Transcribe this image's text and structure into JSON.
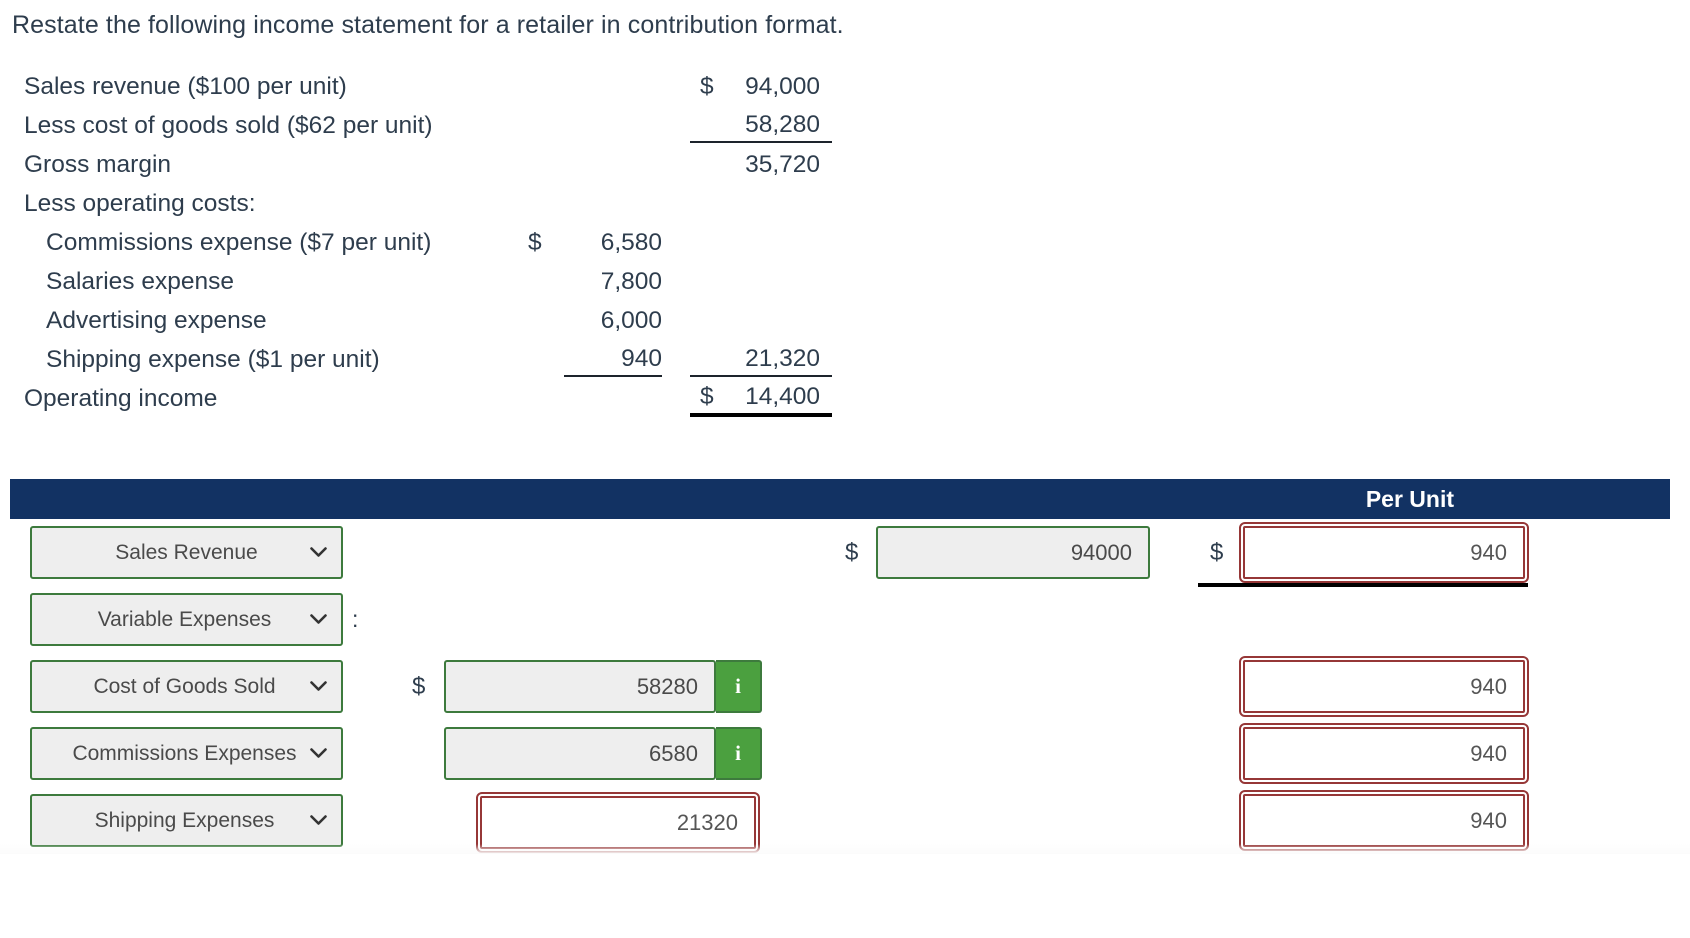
{
  "prompt": "Restate the following income statement for a retailer in contribution format.",
  "income_statement": {
    "rows": [
      {
        "label": "Sales revenue ($100 per unit)",
        "indent": false,
        "d1": "",
        "n1": "",
        "d2": "$",
        "n2": "94,000",
        "rule1": "",
        "rule2": ""
      },
      {
        "label": "Less cost of goods sold ($62 per unit)",
        "indent": false,
        "d1": "",
        "n1": "",
        "d2": "",
        "n2": "58,280",
        "rule1": "",
        "rule2": "thin"
      },
      {
        "label": "Gross margin",
        "indent": false,
        "d1": "",
        "n1": "",
        "d2": "",
        "n2": "35,720",
        "rule1": "",
        "rule2": ""
      },
      {
        "label": "Less operating costs:",
        "indent": false,
        "d1": "",
        "n1": "",
        "d2": "",
        "n2": "",
        "rule1": "",
        "rule2": ""
      },
      {
        "label": "Commissions expense ($7 per unit)",
        "indent": true,
        "d1": "$",
        "n1": "6,580",
        "d2": "",
        "n2": "",
        "rule1": "",
        "rule2": ""
      },
      {
        "label": "Salaries expense",
        "indent": true,
        "d1": "",
        "n1": "7,800",
        "d2": "",
        "n2": "",
        "rule1": "",
        "rule2": ""
      },
      {
        "label": "Advertising expense",
        "indent": true,
        "d1": "",
        "n1": "6,000",
        "d2": "",
        "n2": "",
        "rule1": "",
        "rule2": ""
      },
      {
        "label": "Shipping expense ($1 per unit)",
        "indent": true,
        "d1": "",
        "n1": "940",
        "d2": "",
        "n2": "21,320",
        "rule1": "thin",
        "rule2": "thin"
      },
      {
        "label": "Operating income",
        "indent": false,
        "d1": "",
        "n1": "",
        "d2": "$",
        "n2": "14,400",
        "rule1": "",
        "rule2": "thick"
      }
    ]
  },
  "worksheet": {
    "header": {
      "per_unit_label": "Per Unit"
    },
    "rows": [
      {
        "select_value": "Sales Revenue",
        "colon": "",
        "mid_dollar": "",
        "mid_value": "",
        "mid_style": "none",
        "info_icon": "",
        "amount_dollar": "$",
        "amount_value": "94000",
        "per_unit_dollar": "$",
        "per_unit_value": "940",
        "underline": true
      },
      {
        "select_value": "Variable Expenses",
        "colon": ":",
        "mid_dollar": "",
        "mid_value": "",
        "mid_style": "none",
        "info_icon": "",
        "amount_dollar": "",
        "amount_value": "",
        "per_unit_dollar": "",
        "per_unit_value": "",
        "underline": false
      },
      {
        "select_value": "Cost of Goods Sold",
        "colon": "",
        "mid_dollar": "$",
        "mid_value": "58280",
        "mid_style": "green",
        "info_icon": "i",
        "amount_dollar": "",
        "amount_value": "",
        "per_unit_dollar": "",
        "per_unit_value": "940",
        "underline": false
      },
      {
        "select_value": "Commissions Expenses",
        "colon": "",
        "mid_dollar": "",
        "mid_value": "6580",
        "mid_style": "green",
        "info_icon": "i",
        "amount_dollar": "",
        "amount_value": "",
        "per_unit_dollar": "",
        "per_unit_value": "940",
        "underline": false
      },
      {
        "select_value": "Shipping Expenses",
        "colon": "",
        "mid_dollar": "",
        "mid_value": "21320",
        "mid_style": "red",
        "info_icon": "",
        "amount_dollar": "",
        "amount_value": "",
        "per_unit_dollar": "",
        "per_unit_value": "940",
        "underline": false
      }
    ],
    "icons": {
      "chevron": "⌄",
      "chevron_down": "chevron-down-icon"
    }
  },
  "colors": {
    "header_blue": "#123263",
    "valid_green": "#3d7a3d",
    "info_green": "#4ba03f",
    "error_red": "#963737",
    "text": "#2e3d4d"
  }
}
